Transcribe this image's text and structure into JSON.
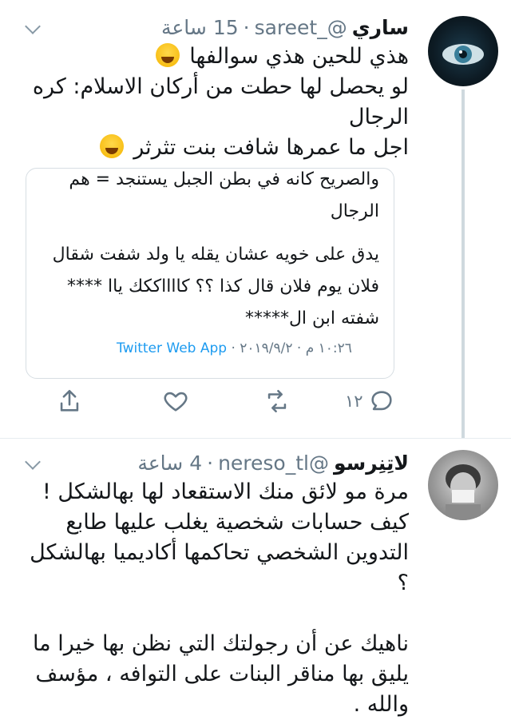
{
  "tweet1": {
    "name": "ساري",
    "handle": "@_sareet",
    "time": "15 ساعة",
    "lines": [
      "هذي للحين هذي سوالفها",
      "لو يحصل لها حطت من أركان الاسلام: كره الرجال",
      "اجل ما عمرها شافت بنت تثرثر"
    ],
    "quote": {
      "lines": [
        "والصريح كانه في بطن الجبل يستنجد = هم الرجال",
        "يدق على خويه عشان يقله يا ولد شفت شقال فلان يوم فلان قال كذا ؟؟ كااااككك ياا **** شفته ابن ال*****"
      ],
      "timestamp": "١٠:٢٦ م · ٢٠١٩/٩/٢ ·",
      "app": "Twitter Web App"
    },
    "actions": {
      "reply_count": "١٢"
    }
  },
  "tweet2": {
    "name": "لاتِنِرسو",
    "handle": "@nereso_tl",
    "time": "4 ساعة",
    "paragraphs": [
      "مرة مو لائق منك الاستقعاد لها بهالشكل ! كيف حسابات شخصية يغلب عليها طابع التدوين الشخصي تحاكمها أكاديميا بهالشكل ؟",
      "ناهيك عن أن رجولتك التي نظن بها خيرا ما يليق بها مناقر البنات على التوافه ، مؤسف والله ."
    ]
  },
  "colors": {
    "text": "#14171a",
    "muted": "#657786",
    "link": "#1d9bf0",
    "thread": "#cfd9de"
  },
  "icons": [
    "reply-icon",
    "retweet-icon",
    "like-icon",
    "share-icon",
    "caret-down-icon",
    "laughing-emoji-icon"
  ]
}
